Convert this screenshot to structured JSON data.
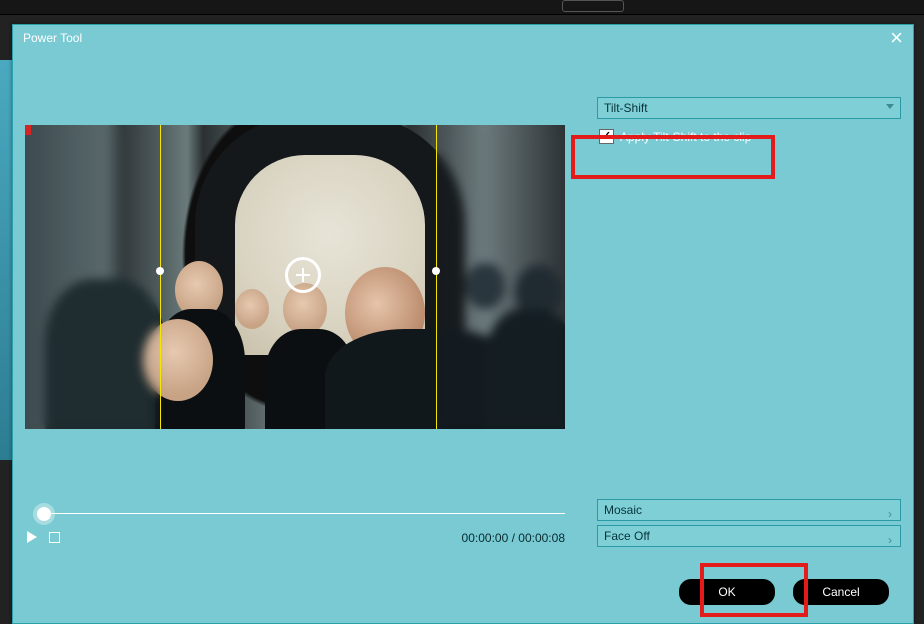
{
  "window": {
    "title": "Power Tool"
  },
  "effects": {
    "selected": "Tilt-Shift",
    "apply_label": "Apply Tilt-Shift to the clip",
    "apply_checked": true,
    "mosaic_label": "Mosaic",
    "faceoff_label": "Face Off"
  },
  "playback": {
    "current": "00:00:00",
    "duration": "00:00:08",
    "separator": " / "
  },
  "buttons": {
    "ok": "OK",
    "cancel": "Cancel"
  },
  "colors": {
    "dialog_bg": "#79cad2",
    "highlight": "#e31b1b",
    "guide": "#f5e600"
  }
}
